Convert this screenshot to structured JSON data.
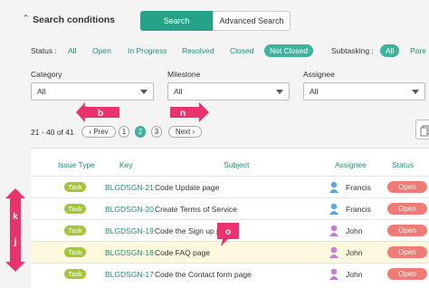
{
  "header": {
    "title": "Search conditions",
    "tab_search": "Search",
    "tab_advanced": "Advanced Search"
  },
  "status": {
    "label": "Status :",
    "options": [
      "All",
      "Open",
      "In Progress",
      "Resolved",
      "Closed",
      "Not Closed"
    ],
    "selected": "Not Closed",
    "subtasking_label": "Subtasking :",
    "subtasking_options": [
      "All",
      "Pare"
    ],
    "subtasking_selected": "All"
  },
  "filters": {
    "category_label": "Category",
    "category_value": "All",
    "milestone_label": "Milestone",
    "milestone_value": "All",
    "assignee_label": "Assignee",
    "assignee_value": "All"
  },
  "pager": {
    "range": "21 - 40 of 41",
    "prev": "Prev",
    "pages": [
      "1",
      "2",
      "3"
    ],
    "current": "2",
    "next": "Next"
  },
  "table": {
    "headers": [
      "Issue Type",
      "Key",
      "Subject",
      "Assignee",
      "Status"
    ],
    "rows": [
      {
        "type": "Task",
        "key": "BLGDSGN-21",
        "subject": "Code Update page",
        "assignee": "Francis",
        "status": "Open"
      },
      {
        "type": "Task",
        "key": "BLGDSGN-20",
        "subject": "Create Terms of Service",
        "assignee": "Francis",
        "status": "Open"
      },
      {
        "type": "Task",
        "key": "BLGDSGN-19",
        "subject": "Code the Sign up page",
        "assignee": "John",
        "status": "Open"
      },
      {
        "type": "Task",
        "key": "BLGDSGN-18",
        "subject": "Code FAQ page",
        "assignee": "John",
        "status": "Open"
      },
      {
        "type": "Task",
        "key": "BLGDSGN-17",
        "subject": "Code the Contact form page",
        "assignee": "John",
        "status": "Open"
      }
    ]
  },
  "annotations": {
    "b": "b",
    "n": "n",
    "k": "k",
    "j": "j",
    "o": "o"
  },
  "colors": {
    "accent": "#26a288",
    "link": "#1d8f7a",
    "task_badge": "#a5c53a",
    "open_badge": "#f07b76",
    "annotation": "#e8336d",
    "highlight_row": "#fdf9de"
  }
}
